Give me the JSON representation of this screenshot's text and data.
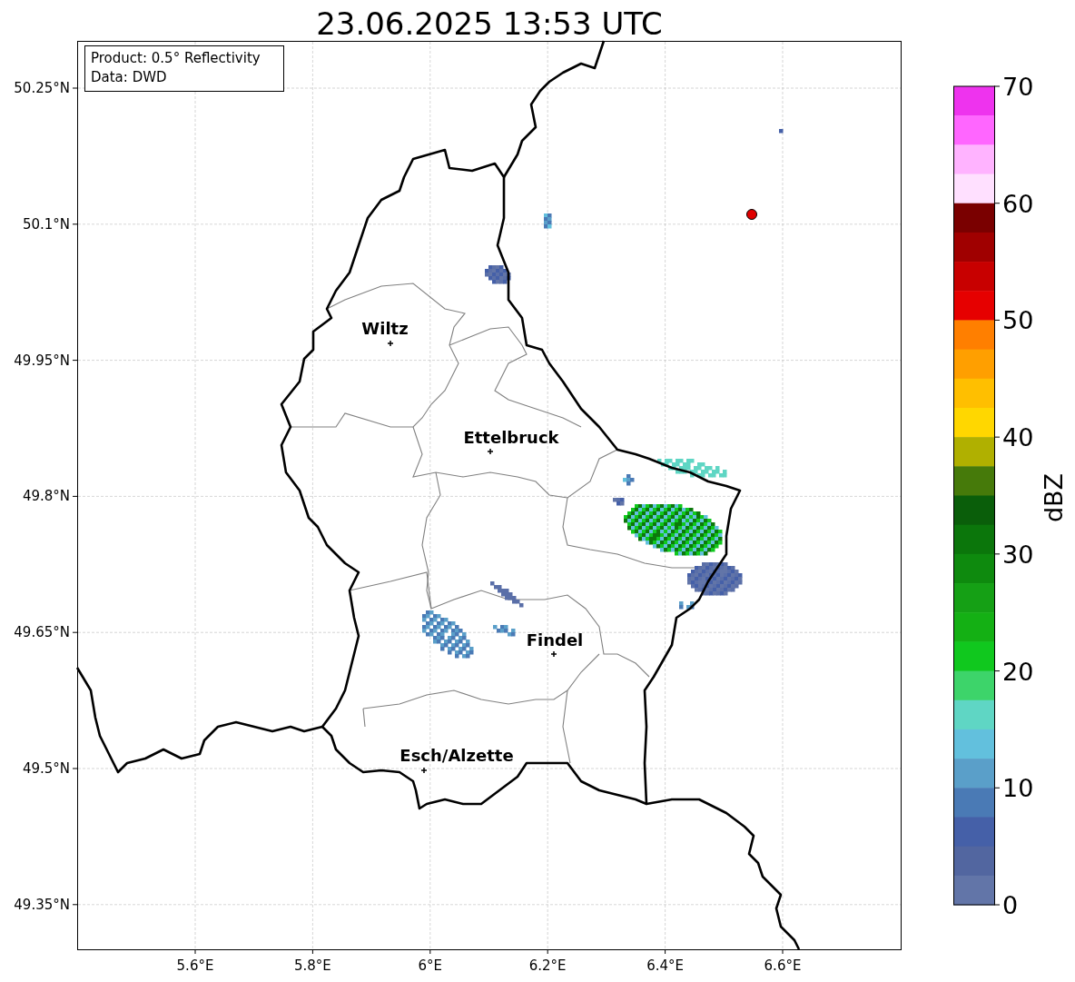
{
  "title": "23.06.2025 13:53 UTC",
  "legend": [
    "Product: 0.5° Reflectivity",
    "Data: DWD"
  ],
  "lat_ticks": [
    "50.25°N",
    "50.1°N",
    "49.95°N",
    "49.8°N",
    "49.65°N",
    "49.5°N",
    "49.35°N"
  ],
  "lon_ticks": [
    "5.6°E",
    "5.8°E",
    "6°E",
    "6.2°E",
    "6.4°E",
    "6.6°E"
  ],
  "cities": [
    {
      "name": "Wiltz"
    },
    {
      "name": "Ettelbruck"
    },
    {
      "name": "Findel"
    },
    {
      "name": "Esch/Alzette"
    }
  ],
  "colorbar": {
    "label": "dBZ",
    "ticks": [
      "70",
      "60",
      "50",
      "40",
      "30",
      "20",
      "10",
      "0"
    ],
    "bins": [
      {
        "color": "#ee33ee"
      },
      {
        "color": "#ff66ff"
      },
      {
        "color": "#ffb3ff"
      },
      {
        "color": "#ffe0ff"
      },
      {
        "color": "#7a0000"
      },
      {
        "color": "#a00000"
      },
      {
        "color": "#c80000"
      },
      {
        "color": "#e60000"
      },
      {
        "color": "#ff7f00"
      },
      {
        "color": "#ff9f00"
      },
      {
        "color": "#ffbf00"
      },
      {
        "color": "#ffd700"
      },
      {
        "color": "#b0b000"
      },
      {
        "color": "#467a0a"
      },
      {
        "color": "#0a5e0a"
      },
      {
        "color": "#0b760b"
      },
      {
        "color": "#0e8a0e"
      },
      {
        "color": "#15a015"
      },
      {
        "color": "#14b014"
      },
      {
        "color": "#10c81e"
      },
      {
        "color": "#3dd46a"
      },
      {
        "color": "#5fd6c4"
      },
      {
        "color": "#62c0dd"
      },
      {
        "color": "#5a9fc9"
      },
      {
        "color": "#4a7ab5"
      },
      {
        "color": "#4560a8"
      },
      {
        "color": "#5266a0"
      },
      {
        "color": "#6275a8"
      }
    ]
  }
}
